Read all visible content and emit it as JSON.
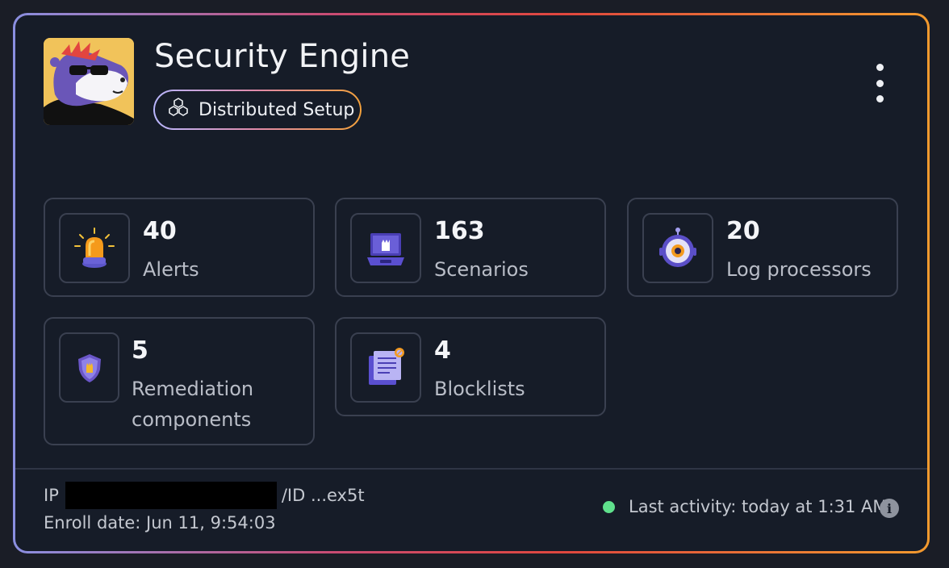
{
  "header": {
    "title": "Security Engine",
    "badge_label": "Distributed Setup",
    "avatar_icon": "mascot-avatar",
    "menu_icon": "kebab-menu-icon"
  },
  "stats": [
    {
      "value": "40",
      "label": "Alerts",
      "icon": "siren-icon"
    },
    {
      "value": "163",
      "label": "Scenarios",
      "icon": "laptop-icon"
    },
    {
      "value": "20",
      "label": "Log processors",
      "icon": "robot-eye-icon"
    },
    {
      "value": "5",
      "label": "Remediation components",
      "icon": "shield-icon"
    },
    {
      "value": "4",
      "label": "Blocklists",
      "icon": "document-list-icon"
    }
  ],
  "footer": {
    "ip_label": "IP",
    "id_label": "/ID ...ex5t",
    "enroll_date": "Enroll date: Jun 11, 9:54:03",
    "last_activity": "Last activity: today at 1:31 AM",
    "status_color": "#5fe08c",
    "info_icon_glyph": "i"
  },
  "colors": {
    "background": "#161c28",
    "border_gradient": [
      "#8a8fe0",
      "#c94b72",
      "#e0473e",
      "#f39a2e"
    ],
    "tile_border": "#3a4050"
  }
}
